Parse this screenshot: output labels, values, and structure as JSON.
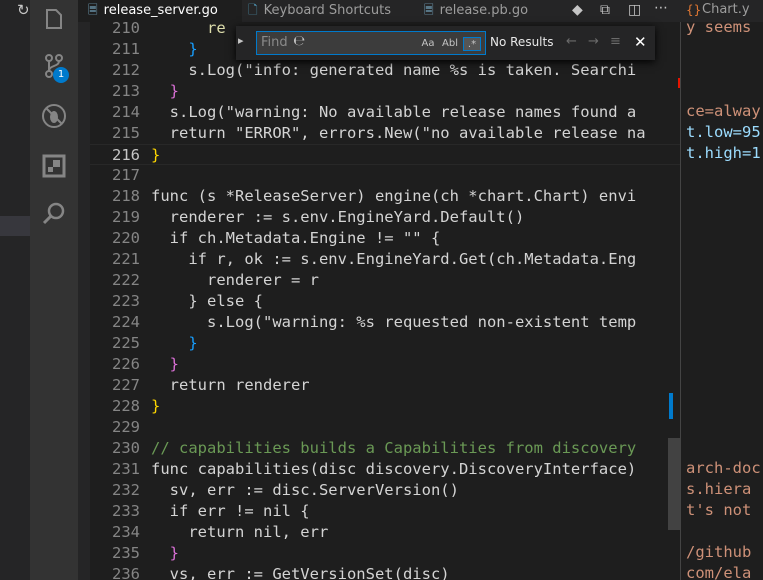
{
  "left_strip": {
    "refresh_glyph": "↻"
  },
  "activity_bar": {
    "items": [
      {
        "name": "explorer-icon"
      },
      {
        "name": "source-control-icon",
        "badge": "1"
      },
      {
        "name": "debug-icon"
      },
      {
        "name": "extensions-icon"
      },
      {
        "name": "search-icon"
      }
    ]
  },
  "tabs": [
    {
      "label": "release_server.go",
      "active": true
    },
    {
      "label": "Keyboard Shortcuts",
      "active": false
    },
    {
      "label": "release.pb.go",
      "active": false
    },
    {
      "label": "Chart.y",
      "active": false
    }
  ],
  "find_widget": {
    "placeholder": "Find",
    "match_case": "Aa",
    "whole_word": "Abl",
    "regex": ".*",
    "status": "No Results"
  },
  "editor": {
    "lines": [
      {
        "n": "210",
        "code": "      re"
      },
      {
        "n": "211",
        "code": "    }"
      },
      {
        "n": "212",
        "code": "    s.Log(\"info: generated name %s is taken. Searchi"
      },
      {
        "n": "213",
        "code": "  }"
      },
      {
        "n": "214",
        "code": "  s.Log(\"warning: No available release names found a"
      },
      {
        "n": "215",
        "code": "  return \"ERROR\", errors.New(\"no available release na"
      },
      {
        "n": "216",
        "code": "}"
      },
      {
        "n": "217",
        "code": ""
      },
      {
        "n": "218",
        "code": "func (s *ReleaseServer) engine(ch *chart.Chart) envi"
      },
      {
        "n": "219",
        "code": "  renderer := s.env.EngineYard.Default()"
      },
      {
        "n": "220",
        "code": "  if ch.Metadata.Engine != \"\" {"
      },
      {
        "n": "221",
        "code": "    if r, ok := s.env.EngineYard.Get(ch.Metadata.Eng"
      },
      {
        "n": "222",
        "code": "      renderer = r"
      },
      {
        "n": "223",
        "code": "    } else {"
      },
      {
        "n": "224",
        "code": "      s.Log(\"warning: %s requested non-existent temp"
      },
      {
        "n": "225",
        "code": "    }"
      },
      {
        "n": "226",
        "code": "  }"
      },
      {
        "n": "227",
        "code": "  return renderer"
      },
      {
        "n": "228",
        "code": "}"
      },
      {
        "n": "229",
        "code": ""
      },
      {
        "n": "230",
        "code": "// capabilities builds a Capabilities from discovery"
      },
      {
        "n": "231",
        "code": "func capabilities(disc discovery.DiscoveryInterface)"
      },
      {
        "n": "232",
        "code": "  sv, err := disc.ServerVersion()"
      },
      {
        "n": "233",
        "code": "  if err != nil {"
      },
      {
        "n": "234",
        "code": "    return nil, err"
      },
      {
        "n": "235",
        "code": "  }"
      },
      {
        "n": "236",
        "code": "  vs, err := GetVersionSet(disc)"
      }
    ],
    "active_line": "216"
  },
  "right_pane": {
    "lines": [
      {
        "text": "y seems"
      },
      {
        "text": ""
      },
      {
        "text": ""
      },
      {
        "text": ""
      },
      {
        "text": "ce=alway"
      },
      {
        "text": "t.low=95"
      },
      {
        "text": "t.high=1"
      },
      {
        "text": ""
      },
      {
        "text": ""
      },
      {
        "text": ""
      },
      {
        "text": ""
      },
      {
        "text": ""
      },
      {
        "text": ""
      },
      {
        "text": ""
      },
      {
        "text": ""
      },
      {
        "text": ""
      },
      {
        "text": ""
      },
      {
        "text": ""
      },
      {
        "text": ""
      },
      {
        "text": ""
      },
      {
        "text": ""
      },
      {
        "text": "arch-doc"
      },
      {
        "text": "s.hiera"
      },
      {
        "text": "t's not"
      },
      {
        "text": ""
      },
      {
        "text": "/github"
      },
      {
        "text": "com/ela"
      }
    ]
  }
}
